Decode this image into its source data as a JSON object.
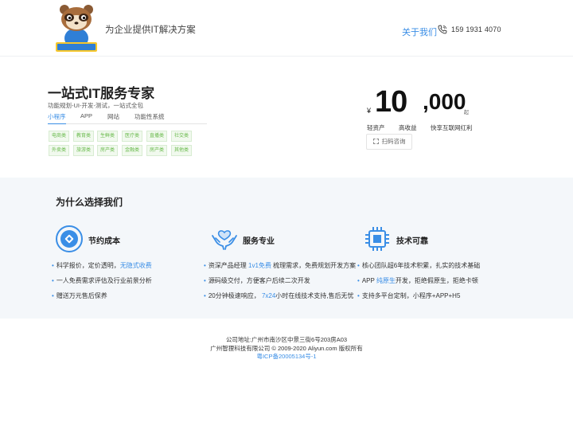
{
  "header": {
    "logo_text": "智狸科技",
    "tagline": "为企业提供IT解决方案",
    "about": "关于我们",
    "phone": "159 1931 4070"
  },
  "hero": {
    "title": "一站式IT服务专家",
    "subtitle": "功能规划-UI-开发-测试，一站式全包",
    "tabs": [
      "小程序",
      "APP",
      "网站",
      "功能性系统"
    ],
    "active_tab": 0,
    "tags": [
      "电商类",
      "教育类",
      "生鲜类",
      "医疗类",
      "直播类",
      "社交类",
      "外卖类",
      "旅游类",
      "房产类",
      "金融类",
      "房产类",
      "其他类"
    ],
    "currency": "¥",
    "price_big": "10",
    "price_rest": ",000",
    "price_suffix": "起",
    "stats": [
      "轻资产",
      "高收益",
      "快享互联网红利"
    ],
    "scan_button": "扫码咨询"
  },
  "why": {
    "title": "为什么选择我们",
    "features": [
      {
        "title": "节约成本",
        "icon": "piggy-coin-icon",
        "bullets": [
          {
            "pre": "科学报价，定价透明，",
            "hl": "无隐式收费",
            "post": ""
          },
          {
            "pre": "一人免费需求评估及行业前景分析",
            "hl": "",
            "post": ""
          },
          {
            "pre": "赠送万元售后保养",
            "hl": "",
            "post": ""
          }
        ]
      },
      {
        "title": "服务专业",
        "icon": "hands-heart-icon",
        "bullets": [
          {
            "pre": "资深产品经理 ",
            "hl": "1v1免费",
            "post": " 梳理需求，免费规划开发方案"
          },
          {
            "pre": "源码级交付，方便客户后续二次开发",
            "hl": "",
            "post": ""
          },
          {
            "pre": "20分钟极速响应， ",
            "hl": "7x24",
            "post": "小时在线技术支持,售后无忧"
          }
        ]
      },
      {
        "title": "技术可靠",
        "icon": "chip-icon",
        "bullets": [
          {
            "pre": "核心团队超6年技术积累，扎实的技术基础",
            "hl": "",
            "post": ""
          },
          {
            "pre": "APP ",
            "hl": "纯原生",
            "post": "开发，拒绝假原生，拒绝卡顿"
          },
          {
            "pre": "支持多平台定制，小程序+APP+H5",
            "hl": "",
            "post": ""
          }
        ]
      }
    ]
  },
  "footer": {
    "address": "公司地址:广州市南沙区中景三街6号203房A03",
    "copyright": "广州智狸科技有限公司 © 2009-2020 Aliyun.com 版权所有",
    "icp": "粤ICP备20005134号-1"
  },
  "colors": {
    "accent": "#3a8ee6",
    "tag_green": "#67b94a",
    "section_bg": "#f4f7fa"
  }
}
